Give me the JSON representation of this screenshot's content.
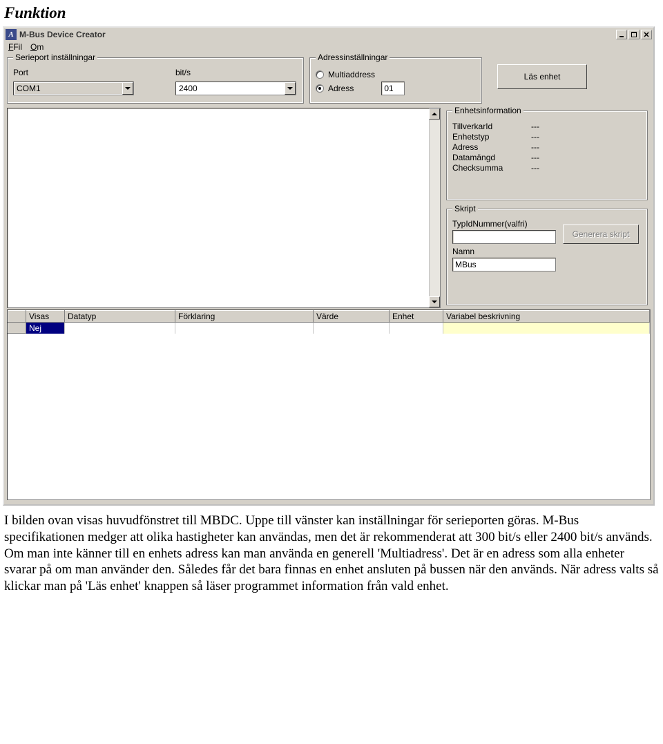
{
  "doc": {
    "heading": "Funktion",
    "body": "I bilden ovan visas huvudfönstret till MBDC. Uppe till vänster kan inställningar för serieporten göras. M-Bus specifikationen medger att olika hastigheter kan användas, men det är rekommenderat att 300 bit/s eller 2400 bit/s används. Om man inte känner till en enhets adress kan man använda en generell 'Multiadress'. Det är en adress som alla enheter svarar på om man använder den. Således får det bara finnas en enhet ansluten på bussen när den används. När adress valts så klickar man på 'Läs enhet' knappen så läser programmet information från vald enhet."
  },
  "window": {
    "title": "M-Bus Device Creator",
    "menu": {
      "file": "Fil",
      "about": "Om"
    }
  },
  "serial": {
    "legend": "Serieport inställningar",
    "port_label": "Port",
    "port_value": "COM1",
    "baud_label": "bit/s",
    "baud_value": "2400"
  },
  "addr": {
    "legend": "Adressinställningar",
    "multi": "Multiaddress",
    "single": "Adress",
    "value": "01",
    "selected": "single"
  },
  "read_btn": "Läs enhet",
  "info": {
    "legend": "Enhetsinformation",
    "rows": {
      "manufacturer": {
        "k": "TillverkarId",
        "v": "---"
      },
      "devtype": {
        "k": "Enhetstyp",
        "v": "---"
      },
      "address": {
        "k": "Adress",
        "v": "---"
      },
      "datasize": {
        "k": "Datamängd",
        "v": "---"
      },
      "checksum": {
        "k": "Checksumma",
        "v": "---"
      }
    }
  },
  "skript": {
    "legend": "Skript",
    "typ_label": "TypIdNummer(valfri)",
    "typ_value": "",
    "namn_label": "Namn",
    "namn_value": "MBus",
    "gen_btn": "Generera skript"
  },
  "grid": {
    "cols": {
      "visas": "Visas",
      "datatyp": "Datatyp",
      "forklaring": "Förklaring",
      "varde": "Värde",
      "enhet": "Enhet",
      "varbesk": "Variabel beskrivning"
    },
    "row1_visas": "Nej"
  }
}
